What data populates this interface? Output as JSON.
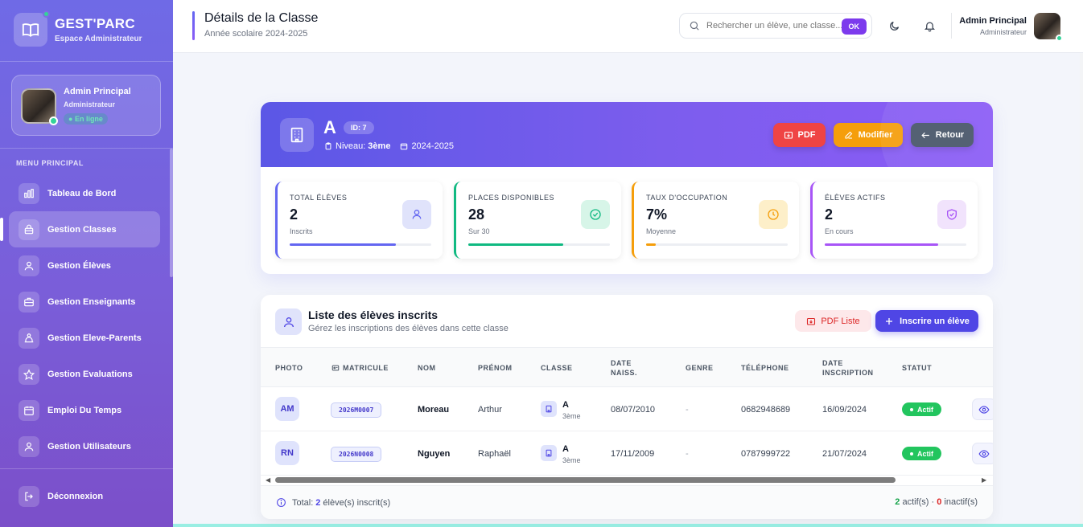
{
  "brand": {
    "title": "GEST'PARC",
    "subtitle": "Espace Administrateur"
  },
  "sidebar_user": {
    "name": "Admin Principal",
    "role": "Administrateur",
    "status": "En ligne"
  },
  "menu": {
    "label": "MENU PRINCIPAL",
    "items": [
      {
        "label": "Tableau de Bord",
        "icon": "chart-bar-icon"
      },
      {
        "label": "Gestion Classes",
        "icon": "school-icon",
        "active": true
      },
      {
        "label": "Gestion Élèves",
        "icon": "users-icon"
      },
      {
        "label": "Gestion Enseignants",
        "icon": "briefcase-icon"
      },
      {
        "label": "Gestion Eleve-Parents",
        "icon": "family-icon"
      },
      {
        "label": "Gestion Evaluations",
        "icon": "star-icon"
      },
      {
        "label": "Emploi Du Temps",
        "icon": "calendar-icon"
      },
      {
        "label": "Gestion Utilisateurs",
        "icon": "user-group-icon"
      }
    ],
    "logout": "Déconnexion"
  },
  "header": {
    "title": "Détails de la Classe",
    "subtitle": "Année scolaire 2024-2025",
    "search_placeholder": "Rechercher un élève, une classe...",
    "search_button": "OK",
    "user_name": "Admin Principal",
    "user_role": "Administrateur"
  },
  "class_info": {
    "name": "A",
    "id_badge": "ID: 7",
    "level_label": "Niveau:",
    "level": "3ème",
    "year": "2024-2025",
    "buttons": {
      "pdf": "PDF",
      "edit": "Modifier",
      "back": "Retour"
    }
  },
  "stats": [
    {
      "label": "TOTAL ÉLÈVES",
      "value": "2",
      "sub": "Inscrits",
      "progress": 0.75,
      "color": "#6366f1",
      "bg": "#e0e3fb",
      "icon": "user-icon"
    },
    {
      "label": "PLACES DISPONIBLES",
      "value": "28",
      "sub": "Sur 30",
      "progress": 0.67,
      "color": "#10b981",
      "bg": "#d7f5e8",
      "icon": "check-circle-icon"
    },
    {
      "label": "TAUX D'OCCUPATION",
      "value": "7%",
      "sub": "Moyenne",
      "progress": 0.07,
      "color": "#f59e0b",
      "bg": "#fdefc9",
      "icon": "clock-icon"
    },
    {
      "label": "ÉLÈVES ACTIFS",
      "value": "2",
      "sub": "En cours",
      "progress": 0.8,
      "color": "#a855f7",
      "bg": "#f1e3fc",
      "icon": "shield-check-icon"
    }
  ],
  "students_list": {
    "title": "Liste des élèves inscrits",
    "subtitle": "Gérez les inscriptions des élèves dans cette classe",
    "pdf_button": "PDF Liste",
    "add_button": "Inscrire un élève",
    "columns": [
      "PHOTO",
      "MATRICULE",
      "NOM",
      "PRÉNOM",
      "CLASSE",
      "DATE NAISS.",
      "GENRE",
      "TÉLÉPHONE",
      "DATE INSCRIPTION",
      "STATUT"
    ],
    "rows": [
      {
        "initials": "AM",
        "matricule": "2026M0007",
        "nom": "Moreau",
        "prenom": "Arthur",
        "classe": "A",
        "niveau": "3ème",
        "date_naiss": "08/07/2010",
        "genre": "-",
        "telephone": "0682948689",
        "date_inscription": "16/09/2024",
        "statut": "Actif"
      },
      {
        "initials": "RN",
        "matricule": "2026N0008",
        "nom": "Nguyen",
        "prenom": "Raphaël",
        "classe": "A",
        "niveau": "3ème",
        "date_naiss": "17/11/2009",
        "genre": "-",
        "telephone": "0787999722",
        "date_inscription": "21/07/2024",
        "statut": "Actif"
      }
    ],
    "footer": {
      "total_prefix": "Total:",
      "total_count": "2",
      "total_suffix": "élève(s) inscrit(s)",
      "active_count": "2",
      "active_label": "actif(s) ·",
      "inactive_count": "0",
      "inactive_label": "inactif(s)"
    }
  }
}
